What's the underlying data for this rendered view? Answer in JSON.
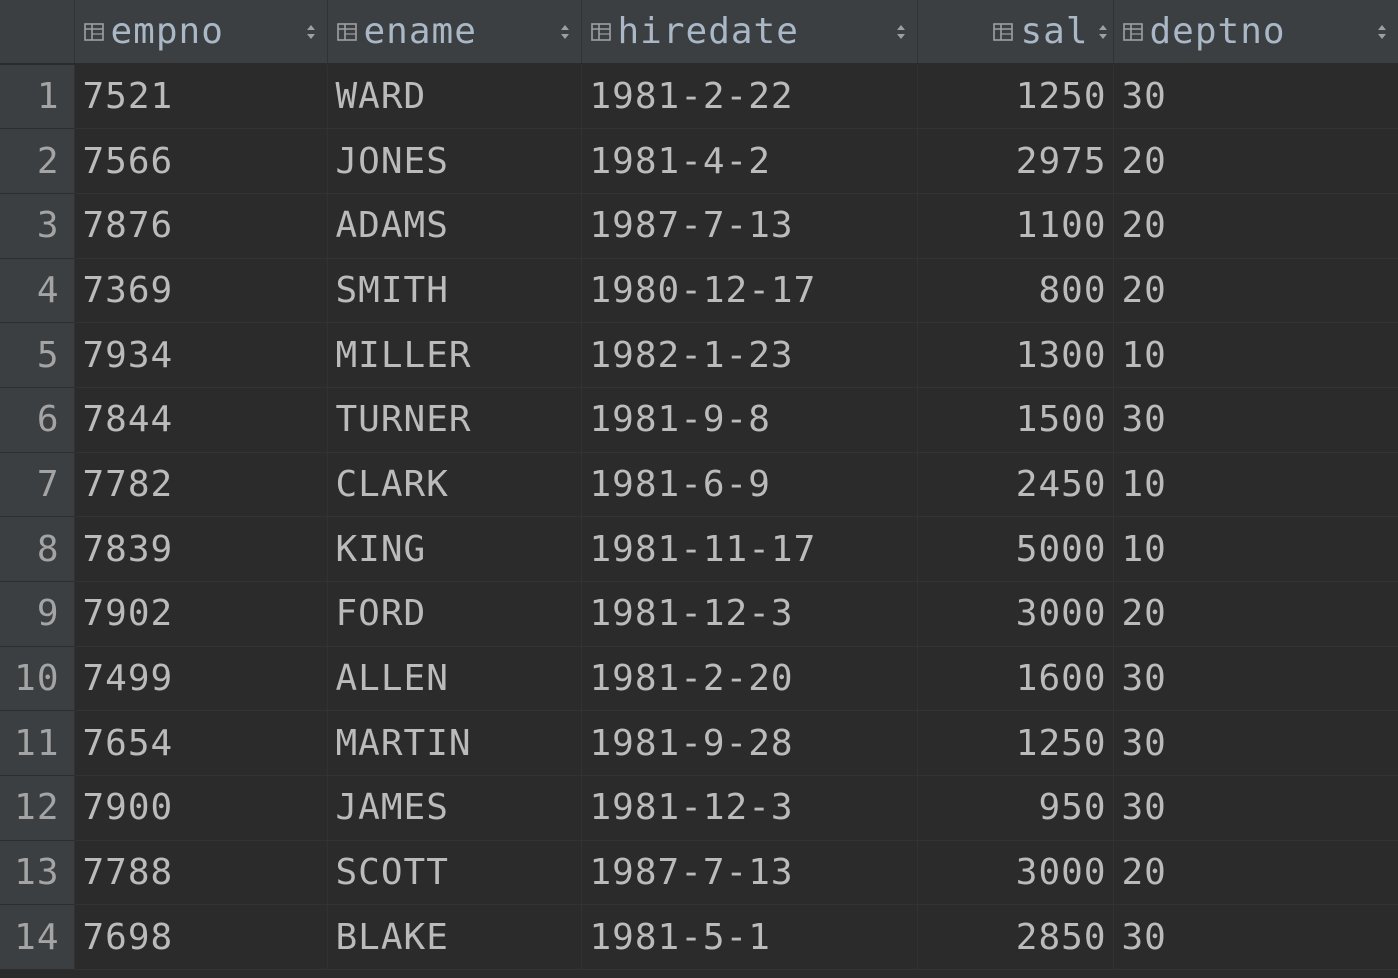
{
  "columns": {
    "empno": {
      "label": "empno",
      "icon": "column-icon"
    },
    "ename": {
      "label": "ename",
      "icon": "column-icon"
    },
    "hiredate": {
      "label": "hiredate",
      "icon": "column-icon"
    },
    "sal": {
      "label": "sal",
      "icon": "column-icon"
    },
    "deptno": {
      "label": "deptno",
      "icon": "column-icon"
    }
  },
  "rows": [
    {
      "n": "1",
      "empno": "7521",
      "ename": "WARD",
      "hiredate": "1981-2-22",
      "sal": "1250",
      "deptno": "30"
    },
    {
      "n": "2",
      "empno": "7566",
      "ename": "JONES",
      "hiredate": "1981-4-2",
      "sal": "2975",
      "deptno": "20"
    },
    {
      "n": "3",
      "empno": "7876",
      "ename": "ADAMS",
      "hiredate": "1987-7-13",
      "sal": "1100",
      "deptno": "20"
    },
    {
      "n": "4",
      "empno": "7369",
      "ename": "SMITH",
      "hiredate": "1980-12-17",
      "sal": "800",
      "deptno": "20"
    },
    {
      "n": "5",
      "empno": "7934",
      "ename": "MILLER",
      "hiredate": "1982-1-23",
      "sal": "1300",
      "deptno": "10"
    },
    {
      "n": "6",
      "empno": "7844",
      "ename": "TURNER",
      "hiredate": "1981-9-8",
      "sal": "1500",
      "deptno": "30"
    },
    {
      "n": "7",
      "empno": "7782",
      "ename": "CLARK",
      "hiredate": "1981-6-9",
      "sal": "2450",
      "deptno": "10"
    },
    {
      "n": "8",
      "empno": "7839",
      "ename": "KING",
      "hiredate": "1981-11-17",
      "sal": "5000",
      "deptno": "10"
    },
    {
      "n": "9",
      "empno": "7902",
      "ename": "FORD",
      "hiredate": "1981-12-3",
      "sal": "3000",
      "deptno": "20"
    },
    {
      "n": "10",
      "empno": "7499",
      "ename": "ALLEN",
      "hiredate": "1981-2-20",
      "sal": "1600",
      "deptno": "30"
    },
    {
      "n": "11",
      "empno": "7654",
      "ename": "MARTIN",
      "hiredate": "1981-9-28",
      "sal": "1250",
      "deptno": "30"
    },
    {
      "n": "12",
      "empno": "7900",
      "ename": "JAMES",
      "hiredate": "1981-12-3",
      "sal": "950",
      "deptno": "30"
    },
    {
      "n": "13",
      "empno": "7788",
      "ename": "SCOTT",
      "hiredate": "1987-7-13",
      "sal": "3000",
      "deptno": "20"
    },
    {
      "n": "14",
      "empno": "7698",
      "ename": "BLAKE",
      "hiredate": "1981-5-1",
      "sal": "2850",
      "deptno": "30"
    }
  ]
}
